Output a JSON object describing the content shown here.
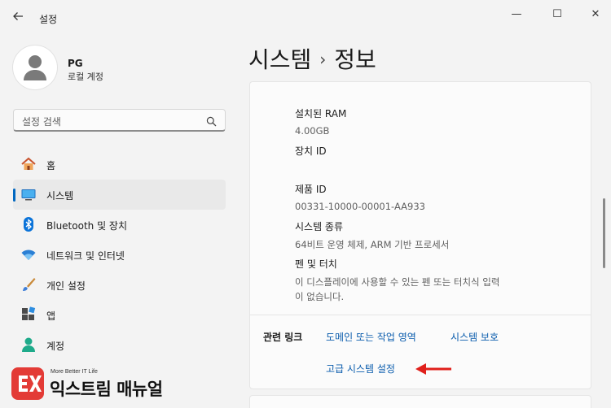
{
  "window": {
    "title": "설정",
    "controls": {
      "minimize": "—",
      "maximize": "☐",
      "close": "✕"
    }
  },
  "profile": {
    "name": "PG",
    "account_type": "로컬 계정"
  },
  "search": {
    "placeholder": "설정 검색"
  },
  "sidebar": {
    "items": [
      {
        "label": "홈",
        "icon": "home-icon",
        "active": false
      },
      {
        "label": "시스템",
        "icon": "system-display-icon",
        "active": true
      },
      {
        "label": "Bluetooth 및 장치",
        "icon": "bluetooth-icon",
        "active": false
      },
      {
        "label": "네트워크 및 인터넷",
        "icon": "wifi-icon",
        "active": false
      },
      {
        "label": "개인 설정",
        "icon": "brush-icon",
        "active": false
      },
      {
        "label": "앱",
        "icon": "apps-icon",
        "active": false
      },
      {
        "label": "계정",
        "icon": "account-icon",
        "active": false
      }
    ]
  },
  "breadcrumb": {
    "parent": "시스템",
    "separator": "›",
    "current": "정보"
  },
  "specs": {
    "ram_label": "설치된 RAM",
    "ram_value": "4.00GB",
    "device_id_label": "장치 ID",
    "product_id_label": "제품 ID",
    "product_id_value": "00331-10000-00001-AA933",
    "system_type_label": "시스템 종류",
    "system_type_value": "64비트 운영 체제, ARM 기반 프로세서",
    "pen_touch_label": "펜 및 터치",
    "pen_touch_value_line1": "이 디스플레이에 사용할 수 있는 펜 또는 터치식 입력",
    "pen_touch_value_line2": "이 없습니다."
  },
  "related": {
    "title": "관련 링크",
    "links": [
      "도메인 또는 작업 영역",
      "시스템 보호",
      "고급 시스템 설정"
    ]
  },
  "watermark": {
    "tagline": "More Better IT Life",
    "name": "익스트림 매뉴얼",
    "brand_color": "#e33b36"
  },
  "colors": {
    "accent": "#0067c0",
    "link": "#0a5cad",
    "annotation_arrow": "#e0201b"
  }
}
